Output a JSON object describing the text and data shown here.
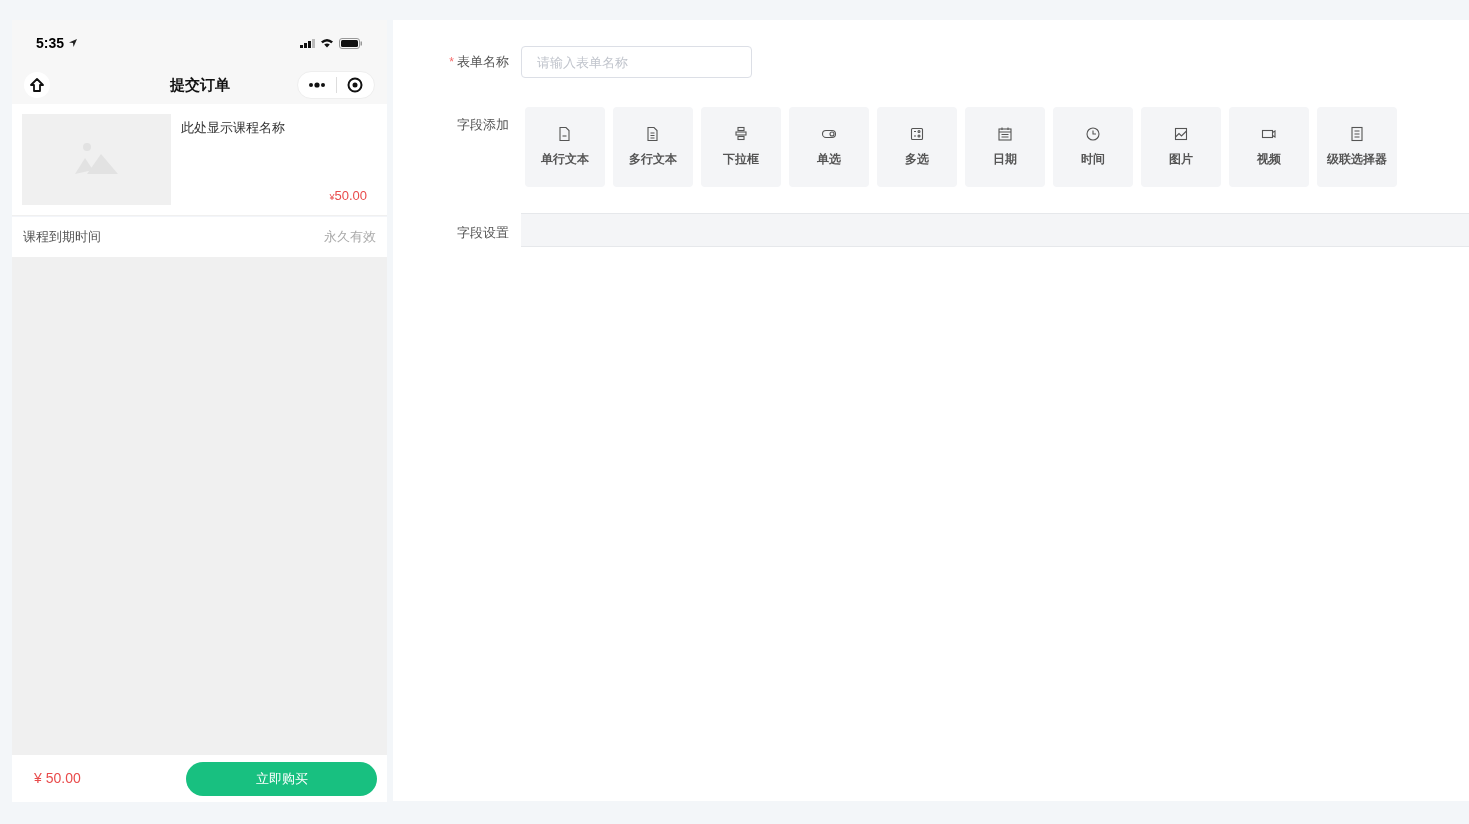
{
  "phone": {
    "status_bar": {
      "time": "5:35"
    },
    "nav": {
      "title": "提交订单"
    },
    "course": {
      "name": "此处显示课程名称",
      "currency": "¥",
      "price": "50.00"
    },
    "expiry": {
      "label": "课程到期时间",
      "value": "永久有效"
    },
    "footer": {
      "total": "¥ 50.00",
      "button": "立即购买"
    }
  },
  "form": {
    "name_field": {
      "label": "表单名称",
      "required": true,
      "required_mark": "*",
      "placeholder": "请输入表单名称"
    },
    "add_label": "字段添加",
    "field_types": [
      {
        "kind": "single",
        "label": "单行文本"
      },
      {
        "kind": "multi",
        "label": "多行文本"
      },
      {
        "kind": "select",
        "label": "下拉框"
      },
      {
        "kind": "radio",
        "label": "单选"
      },
      {
        "kind": "checkbox",
        "label": "多选"
      },
      {
        "kind": "date",
        "label": "日期"
      },
      {
        "kind": "time",
        "label": "时间"
      },
      {
        "kind": "image",
        "label": "图片"
      },
      {
        "kind": "video",
        "label": "视频"
      },
      {
        "kind": "cascader",
        "label": "级联选择器"
      }
    ],
    "settings_label": "字段设置"
  }
}
